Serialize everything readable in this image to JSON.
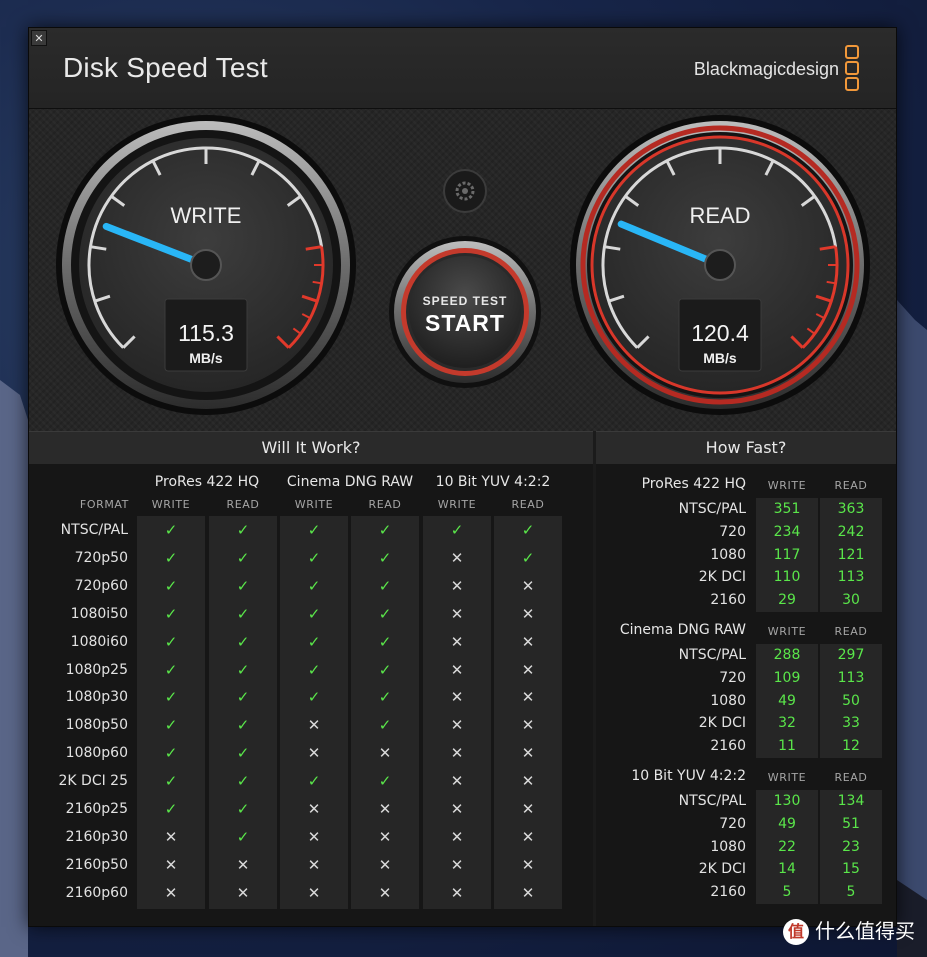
{
  "app": {
    "title": "Disk Speed Test",
    "brand": "Blackmagicdesign",
    "close_glyph": "✕"
  },
  "gauges": {
    "write": {
      "label": "WRITE",
      "value": "115.3",
      "unit": "MB/s",
      "needle_fraction": 0.245
    },
    "read": {
      "label": "READ",
      "value": "120.4",
      "unit": "MB/s",
      "needle_fraction": 0.25
    },
    "start": {
      "sub": "SPEED TEST",
      "main": "START"
    },
    "settings_icon": "gear-icon"
  },
  "will_it_work": {
    "title": "Will It Work?",
    "format_header": "FORMAT",
    "groups": [
      "ProRes 422 HQ",
      "Cinema DNG RAW",
      "10 Bit YUV 4:2:2"
    ],
    "sub_headers": [
      "WRITE",
      "READ",
      "WRITE",
      "READ",
      "WRITE",
      "READ"
    ],
    "check_glyph": "✓",
    "cross_glyph": "✕",
    "rows": [
      {
        "format": "NTSC/PAL",
        "cells": [
          1,
          1,
          1,
          1,
          1,
          1
        ]
      },
      {
        "format": "720p50",
        "cells": [
          1,
          1,
          1,
          1,
          0,
          1
        ]
      },
      {
        "format": "720p60",
        "cells": [
          1,
          1,
          1,
          1,
          0,
          0
        ]
      },
      {
        "format": "1080i50",
        "cells": [
          1,
          1,
          1,
          1,
          0,
          0
        ]
      },
      {
        "format": "1080i60",
        "cells": [
          1,
          1,
          1,
          1,
          0,
          0
        ]
      },
      {
        "format": "1080p25",
        "cells": [
          1,
          1,
          1,
          1,
          0,
          0
        ]
      },
      {
        "format": "1080p30",
        "cells": [
          1,
          1,
          1,
          1,
          0,
          0
        ]
      },
      {
        "format": "1080p50",
        "cells": [
          1,
          1,
          0,
          1,
          0,
          0
        ]
      },
      {
        "format": "1080p60",
        "cells": [
          1,
          1,
          0,
          0,
          0,
          0
        ]
      },
      {
        "format": "2K DCI 25",
        "cells": [
          1,
          1,
          1,
          1,
          0,
          0
        ]
      },
      {
        "format": "2160p25",
        "cells": [
          1,
          1,
          0,
          0,
          0,
          0
        ]
      },
      {
        "format": "2160p30",
        "cells": [
          0,
          1,
          0,
          0,
          0,
          0
        ]
      },
      {
        "format": "2160p50",
        "cells": [
          0,
          0,
          0,
          0,
          0,
          0
        ]
      },
      {
        "format": "2160p60",
        "cells": [
          0,
          0,
          0,
          0,
          0,
          0
        ]
      }
    ]
  },
  "how_fast": {
    "title": "How Fast?",
    "write_label": "WRITE",
    "read_label": "READ",
    "groups": [
      {
        "name": "ProRes 422 HQ",
        "rows": [
          {
            "format": "NTSC/PAL",
            "write": "351",
            "read": "363"
          },
          {
            "format": "720",
            "write": "234",
            "read": "242"
          },
          {
            "format": "1080",
            "write": "117",
            "read": "121"
          },
          {
            "format": "2K DCI",
            "write": "110",
            "read": "113"
          },
          {
            "format": "2160",
            "write": "29",
            "read": "30"
          }
        ]
      },
      {
        "name": "Cinema DNG RAW",
        "rows": [
          {
            "format": "NTSC/PAL",
            "write": "288",
            "read": "297"
          },
          {
            "format": "720",
            "write": "109",
            "read": "113"
          },
          {
            "format": "1080",
            "write": "49",
            "read": "50"
          },
          {
            "format": "2K DCI",
            "write": "32",
            "read": "33"
          },
          {
            "format": "2160",
            "write": "11",
            "read": "12"
          }
        ]
      },
      {
        "name": "10 Bit YUV 4:2:2",
        "rows": [
          {
            "format": "NTSC/PAL",
            "write": "130",
            "read": "134"
          },
          {
            "format": "720",
            "write": "49",
            "read": "51"
          },
          {
            "format": "1080",
            "write": "22",
            "read": "23"
          },
          {
            "format": "2K DCI",
            "write": "14",
            "read": "15"
          },
          {
            "format": "2160",
            "write": "5",
            "read": "5"
          }
        ]
      }
    ]
  },
  "watermark": {
    "icon_text": "值",
    "text": "什么值得买"
  },
  "colors": {
    "accent_green": "#5ae64a",
    "needle_blue": "#29b6f6",
    "alert_red": "#e0392b",
    "brand_orange": "#f1983a"
  }
}
